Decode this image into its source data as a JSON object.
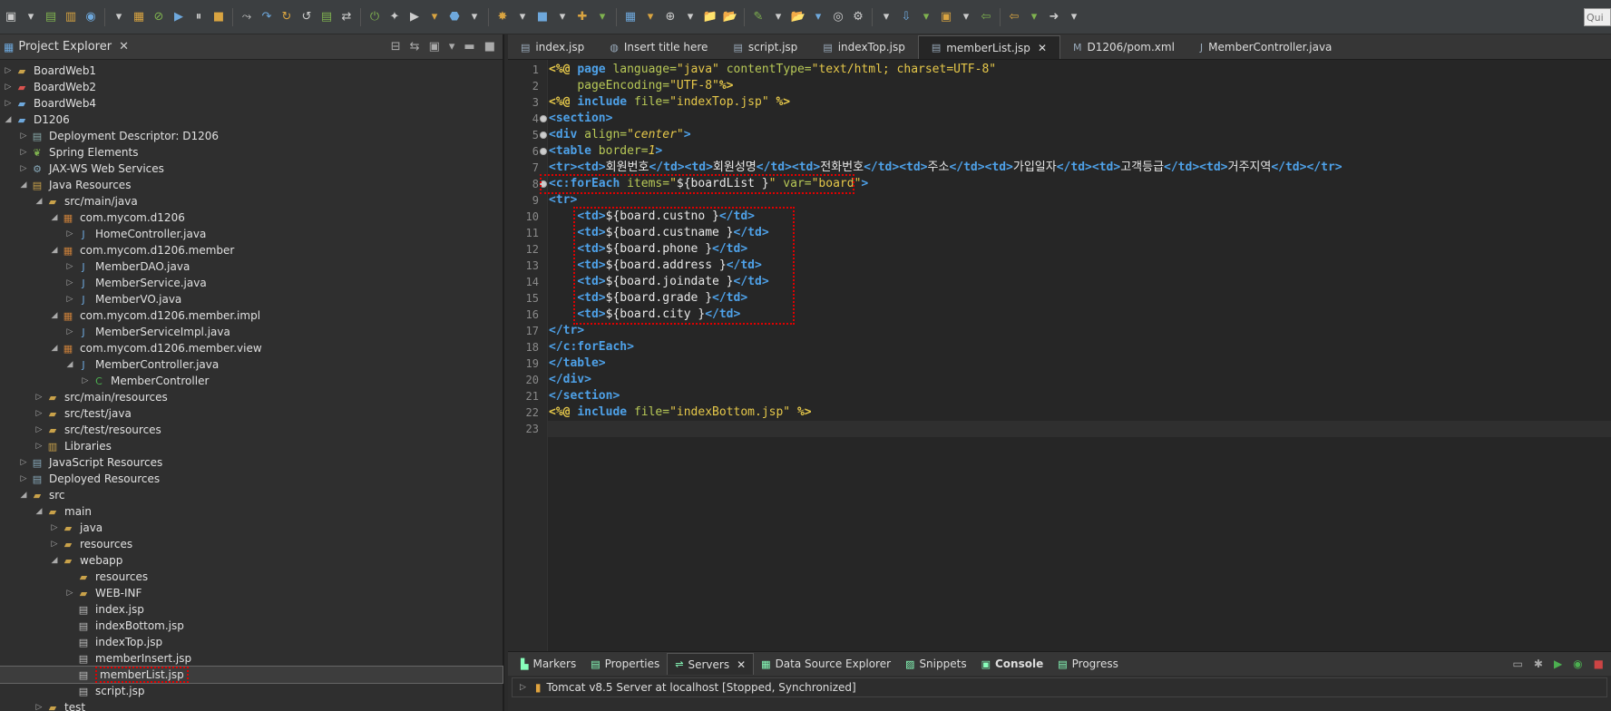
{
  "toolbar": {
    "quick_access": "Qui"
  },
  "explorer": {
    "title": "Project Explorer",
    "items": [
      {
        "label": "BoardWeb1",
        "depth": 0,
        "arrow": "▷",
        "icon": "folder-icon"
      },
      {
        "label": "BoardWeb2",
        "depth": 0,
        "arrow": "▷",
        "icon": "project-error-icon"
      },
      {
        "label": "BoardWeb4",
        "depth": 0,
        "arrow": "▷",
        "icon": "project-icon"
      },
      {
        "label": "D1206",
        "depth": 0,
        "arrow": "◢",
        "icon": "project-icon"
      },
      {
        "label": "Deployment Descriptor: D1206",
        "depth": 1,
        "arrow": "▷",
        "icon": "descriptor-icon"
      },
      {
        "label": "Spring Elements",
        "depth": 1,
        "arrow": "▷",
        "icon": "spring-icon"
      },
      {
        "label": "JAX-WS Web Services",
        "depth": 1,
        "arrow": "▷",
        "icon": "webservice-icon"
      },
      {
        "label": "Java Resources",
        "depth": 1,
        "arrow": "◢",
        "icon": "java-resources-icon"
      },
      {
        "label": "src/main/java",
        "depth": 2,
        "arrow": "◢",
        "icon": "source-folder-icon"
      },
      {
        "label": "com.mycom.d1206",
        "depth": 3,
        "arrow": "◢",
        "icon": "package-icon"
      },
      {
        "label": "HomeController.java",
        "depth": 4,
        "arrow": "▷",
        "icon": "java-file-icon"
      },
      {
        "label": "com.mycom.d1206.member",
        "depth": 3,
        "arrow": "◢",
        "icon": "package-icon"
      },
      {
        "label": "MemberDAO.java",
        "depth": 4,
        "arrow": "▷",
        "icon": "java-file-icon"
      },
      {
        "label": "MemberService.java",
        "depth": 4,
        "arrow": "▷",
        "icon": "java-file-icon"
      },
      {
        "label": "MemberVO.java",
        "depth": 4,
        "arrow": "▷",
        "icon": "java-file-icon"
      },
      {
        "label": "com.mycom.d1206.member.impl",
        "depth": 3,
        "arrow": "◢",
        "icon": "package-icon"
      },
      {
        "label": "MemberServiceImpl.java",
        "depth": 4,
        "arrow": "▷",
        "icon": "java-file-icon"
      },
      {
        "label": "com.mycom.d1206.member.view",
        "depth": 3,
        "arrow": "◢",
        "icon": "package-icon"
      },
      {
        "label": "MemberController.java",
        "depth": 4,
        "arrow": "◢",
        "icon": "java-file-icon"
      },
      {
        "label": "MemberController",
        "depth": 5,
        "arrow": "▷",
        "icon": "class-icon"
      },
      {
        "label": "src/main/resources",
        "depth": 2,
        "arrow": "▷",
        "icon": "source-folder-icon"
      },
      {
        "label": "src/test/java",
        "depth": 2,
        "arrow": "▷",
        "icon": "source-folder-icon"
      },
      {
        "label": "src/test/resources",
        "depth": 2,
        "arrow": "▷",
        "icon": "source-folder-icon"
      },
      {
        "label": "Libraries",
        "depth": 2,
        "arrow": "▷",
        "icon": "library-icon"
      },
      {
        "label": "JavaScript Resources",
        "depth": 1,
        "arrow": "▷",
        "icon": "js-resources-icon"
      },
      {
        "label": "Deployed Resources",
        "depth": 1,
        "arrow": "▷",
        "icon": "deployed-icon"
      },
      {
        "label": "src",
        "depth": 1,
        "arrow": "◢",
        "icon": "folder-icon"
      },
      {
        "label": "main",
        "depth": 2,
        "arrow": "◢",
        "icon": "folder-icon"
      },
      {
        "label": "java",
        "depth": 3,
        "arrow": "▷",
        "icon": "folder-icon"
      },
      {
        "label": "resources",
        "depth": 3,
        "arrow": "▷",
        "icon": "folder-icon"
      },
      {
        "label": "webapp",
        "depth": 3,
        "arrow": "◢",
        "icon": "folder-icon"
      },
      {
        "label": "resources",
        "depth": 4,
        "arrow": "",
        "icon": "folder-icon"
      },
      {
        "label": "WEB-INF",
        "depth": 4,
        "arrow": "▷",
        "icon": "folder-icon"
      },
      {
        "label": "index.jsp",
        "depth": 4,
        "arrow": "",
        "icon": "jsp-file-icon"
      },
      {
        "label": "indexBottom.jsp",
        "depth": 4,
        "arrow": "",
        "icon": "jsp-file-icon"
      },
      {
        "label": "indexTop.jsp",
        "depth": 4,
        "arrow": "",
        "icon": "jsp-file-icon"
      },
      {
        "label": "memberInsert.jsp",
        "depth": 4,
        "arrow": "",
        "icon": "jsp-file-icon"
      },
      {
        "label": "memberList.jsp",
        "depth": 4,
        "arrow": "",
        "icon": "jsp-file-icon",
        "selected": true
      },
      {
        "label": "script.jsp",
        "depth": 4,
        "arrow": "",
        "icon": "jsp-file-icon"
      },
      {
        "label": "test",
        "depth": 2,
        "arrow": "▷",
        "icon": "folder-icon"
      }
    ]
  },
  "tabs": [
    {
      "label": "index.jsp",
      "icon": "jsp-file-icon"
    },
    {
      "label": "Insert title here",
      "icon": "globe-icon"
    },
    {
      "label": "script.jsp",
      "icon": "jsp-file-icon"
    },
    {
      "label": "indexTop.jsp",
      "icon": "jsp-file-icon"
    },
    {
      "label": "memberList.jsp",
      "icon": "jsp-file-icon",
      "active": true
    },
    {
      "label": "D1206/pom.xml",
      "icon": "maven-icon"
    },
    {
      "label": "MemberController.java",
      "icon": "java-file-icon"
    }
  ],
  "code": [
    [
      [
        "t-dir",
        "<%@ "
      ],
      [
        "t-kw",
        "page "
      ],
      [
        "t-att",
        "language="
      ],
      [
        "t-str",
        "\"java\""
      ],
      [
        "t-txt",
        " "
      ],
      [
        "t-att",
        "contentType="
      ],
      [
        "t-str",
        "\"text/html; charset=UTF-8\""
      ]
    ],
    [
      [
        "t-txt",
        "    "
      ],
      [
        "t-att",
        "pageEncoding="
      ],
      [
        "t-str",
        "\"UTF-8\""
      ],
      [
        "t-dir",
        "%>"
      ]
    ],
    [
      [
        "t-dir",
        "<%@ "
      ],
      [
        "t-kw",
        "include "
      ],
      [
        "t-att",
        "file="
      ],
      [
        "t-str",
        "\"indexTop.jsp\""
      ],
      [
        "t-txt",
        " "
      ],
      [
        "t-dir",
        "%>"
      ]
    ],
    [
      [
        "t-tag",
        "<section>"
      ]
    ],
    [
      [
        "t-tag",
        "<div "
      ],
      [
        "t-att",
        "align="
      ],
      [
        "t-istr",
        "\"center\""
      ],
      [
        "t-tag",
        ">"
      ]
    ],
    [
      [
        "t-tag",
        "<table "
      ],
      [
        "t-att",
        "border="
      ],
      [
        "t-istr",
        "1"
      ],
      [
        "t-tag",
        ">"
      ]
    ],
    [
      [
        "t-tag",
        "<tr><td>"
      ],
      [
        "t-txt",
        "회원번호"
      ],
      [
        "t-tag",
        "</td><td>"
      ],
      [
        "t-txt",
        "회원성명"
      ],
      [
        "t-tag",
        "</td><td>"
      ],
      [
        "t-txt",
        "전화번호"
      ],
      [
        "t-tag",
        "</td><td>"
      ],
      [
        "t-txt",
        "주소"
      ],
      [
        "t-tag",
        "</td><td>"
      ],
      [
        "t-txt",
        "가입일자"
      ],
      [
        "t-tag",
        "</td><td>"
      ],
      [
        "t-txt",
        "고객등급"
      ],
      [
        "t-tag",
        "</td><td>"
      ],
      [
        "t-txt",
        "거주지역"
      ],
      [
        "t-tag",
        "</td></tr>"
      ]
    ],
    [
      [
        "t-tag",
        "<c:forEach "
      ],
      [
        "t-att",
        "items="
      ],
      [
        "t-str",
        "\""
      ],
      [
        "t-txt",
        "${boardList }"
      ],
      [
        "t-str",
        "\""
      ],
      [
        "t-txt",
        " "
      ],
      [
        "t-att",
        "var="
      ],
      [
        "t-str",
        "\"board\""
      ],
      [
        "t-tag",
        ">"
      ]
    ],
    [
      [
        "t-tag",
        "<tr>"
      ]
    ],
    [
      [
        "t-txt",
        "    "
      ],
      [
        "t-tag",
        "<td>"
      ],
      [
        "t-txt",
        "${board.custno }"
      ],
      [
        "t-tag",
        "</td>"
      ]
    ],
    [
      [
        "t-txt",
        "    "
      ],
      [
        "t-tag",
        "<td>"
      ],
      [
        "t-txt",
        "${board.custname }"
      ],
      [
        "t-tag",
        "</td>"
      ]
    ],
    [
      [
        "t-txt",
        "    "
      ],
      [
        "t-tag",
        "<td>"
      ],
      [
        "t-txt",
        "${board.phone }"
      ],
      [
        "t-tag",
        "</td>"
      ]
    ],
    [
      [
        "t-txt",
        "    "
      ],
      [
        "t-tag",
        "<td>"
      ],
      [
        "t-txt",
        "${board.address }"
      ],
      [
        "t-tag",
        "</td>"
      ]
    ],
    [
      [
        "t-txt",
        "    "
      ],
      [
        "t-tag",
        "<td>"
      ],
      [
        "t-txt",
        "${board.joindate }"
      ],
      [
        "t-tag",
        "</td>"
      ]
    ],
    [
      [
        "t-txt",
        "    "
      ],
      [
        "t-tag",
        "<td>"
      ],
      [
        "t-txt",
        "${board.grade }"
      ],
      [
        "t-tag",
        "</td>"
      ]
    ],
    [
      [
        "t-txt",
        "    "
      ],
      [
        "t-tag",
        "<td>"
      ],
      [
        "t-txt",
        "${board.city }"
      ],
      [
        "t-tag",
        "</td>"
      ]
    ],
    [
      [
        "t-tag",
        "</tr>"
      ]
    ],
    [
      [
        "t-tag",
        "</c:forEach>"
      ]
    ],
    [
      [
        "t-tag",
        "</table>"
      ]
    ],
    [
      [
        "t-tag",
        "</div>"
      ]
    ],
    [
      [
        "t-tag",
        "</section>"
      ]
    ],
    [
      [
        "t-dir",
        "<%@ "
      ],
      [
        "t-kw",
        "include "
      ],
      [
        "t-att",
        "file="
      ],
      [
        "t-str",
        "\"indexBottom.jsp\""
      ],
      [
        "t-txt",
        " "
      ],
      [
        "t-dir",
        "%>"
      ]
    ],
    []
  ],
  "line_numbers": [
    "1",
    "2",
    "3",
    "4",
    "5",
    "6",
    "7",
    "8",
    "9",
    "10",
    "11",
    "12",
    "13",
    "14",
    "15",
    "16",
    "17",
    "18",
    "19",
    "20",
    "21",
    "22",
    "23"
  ],
  "fold_lines": [
    4,
    5,
    6,
    8
  ],
  "bottom": {
    "tabs": [
      {
        "label": "Markers",
        "icon": "markers-icon"
      },
      {
        "label": "Properties",
        "icon": "properties-icon"
      },
      {
        "label": "Servers",
        "icon": "servers-icon",
        "active": true
      },
      {
        "label": "Data Source Explorer",
        "icon": "datasource-icon"
      },
      {
        "label": "Snippets",
        "icon": "snippets-icon"
      },
      {
        "label": "Console",
        "icon": "console-icon",
        "strong": true
      },
      {
        "label": "Progress",
        "icon": "progress-icon"
      }
    ],
    "server": "Tomcat v8.5 Server at localhost  [Stopped, Synchronized]"
  }
}
